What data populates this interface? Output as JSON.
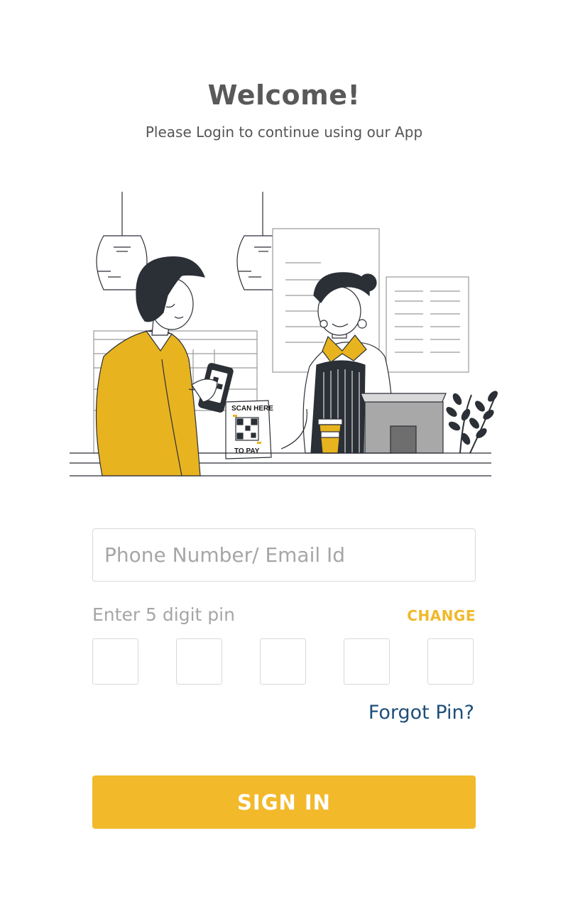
{
  "header": {
    "title": "Welcome!",
    "subtitle": "Please Login to continue using our App"
  },
  "illustration": {
    "sign_top": "SCAN HERE",
    "sign_bottom": "TO PAY"
  },
  "login": {
    "phone_email_placeholder": "Phone Number/ Email Id",
    "phone_email_value": "",
    "pin_label": "Enter 5 digit pin",
    "change_label": "CHANGE",
    "pin_digits": [
      "",
      "",
      "",
      "",
      ""
    ],
    "forgot_label": "Forgot Pin?",
    "signin_label": "SIGN IN"
  },
  "colors": {
    "accent": "#f2b92b",
    "link": "#1e4f7a",
    "title": "#595959",
    "placeholder": "#a6a6a6"
  }
}
